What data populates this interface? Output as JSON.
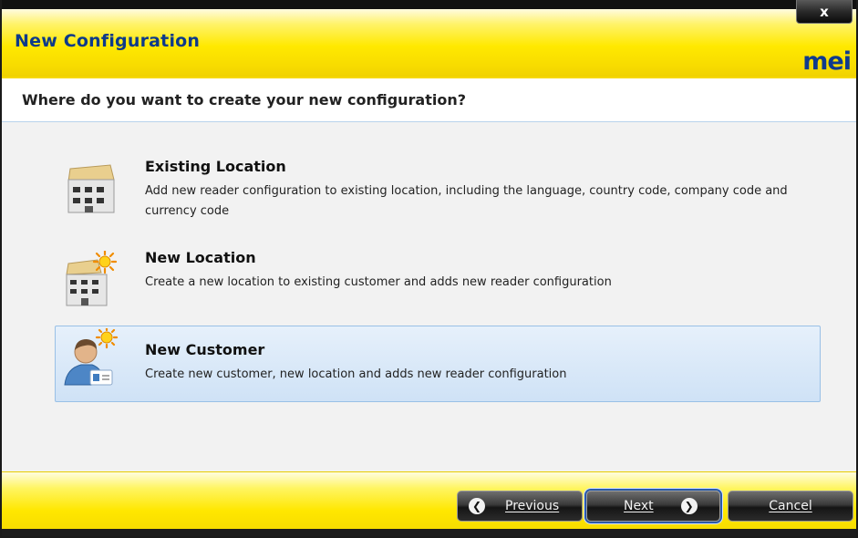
{
  "window": {
    "title": "New Configuration",
    "logo_text": "mei",
    "close_label": "x"
  },
  "question": "Where do you want to create your new configuration?",
  "options": [
    {
      "title": "Existing Location",
      "description": "Add new reader configuration to existing location, including the language, country code, company code and currency code",
      "icon": "building-icon",
      "selected": false
    },
    {
      "title": "New Location",
      "description": "Create a new location to existing customer and adds new reader configuration",
      "icon": "new-building-icon",
      "selected": false
    },
    {
      "title": "New Customer",
      "description": "Create new customer, new location and adds new reader configuration",
      "icon": "new-customer-icon",
      "selected": true
    }
  ],
  "buttons": {
    "previous": "Previous",
    "next": "Next",
    "cancel": "Cancel"
  },
  "colors": {
    "title_text": "#0d3a8a",
    "header_yellow": "#ffe900",
    "selection_blue": "#cfe2f6"
  }
}
